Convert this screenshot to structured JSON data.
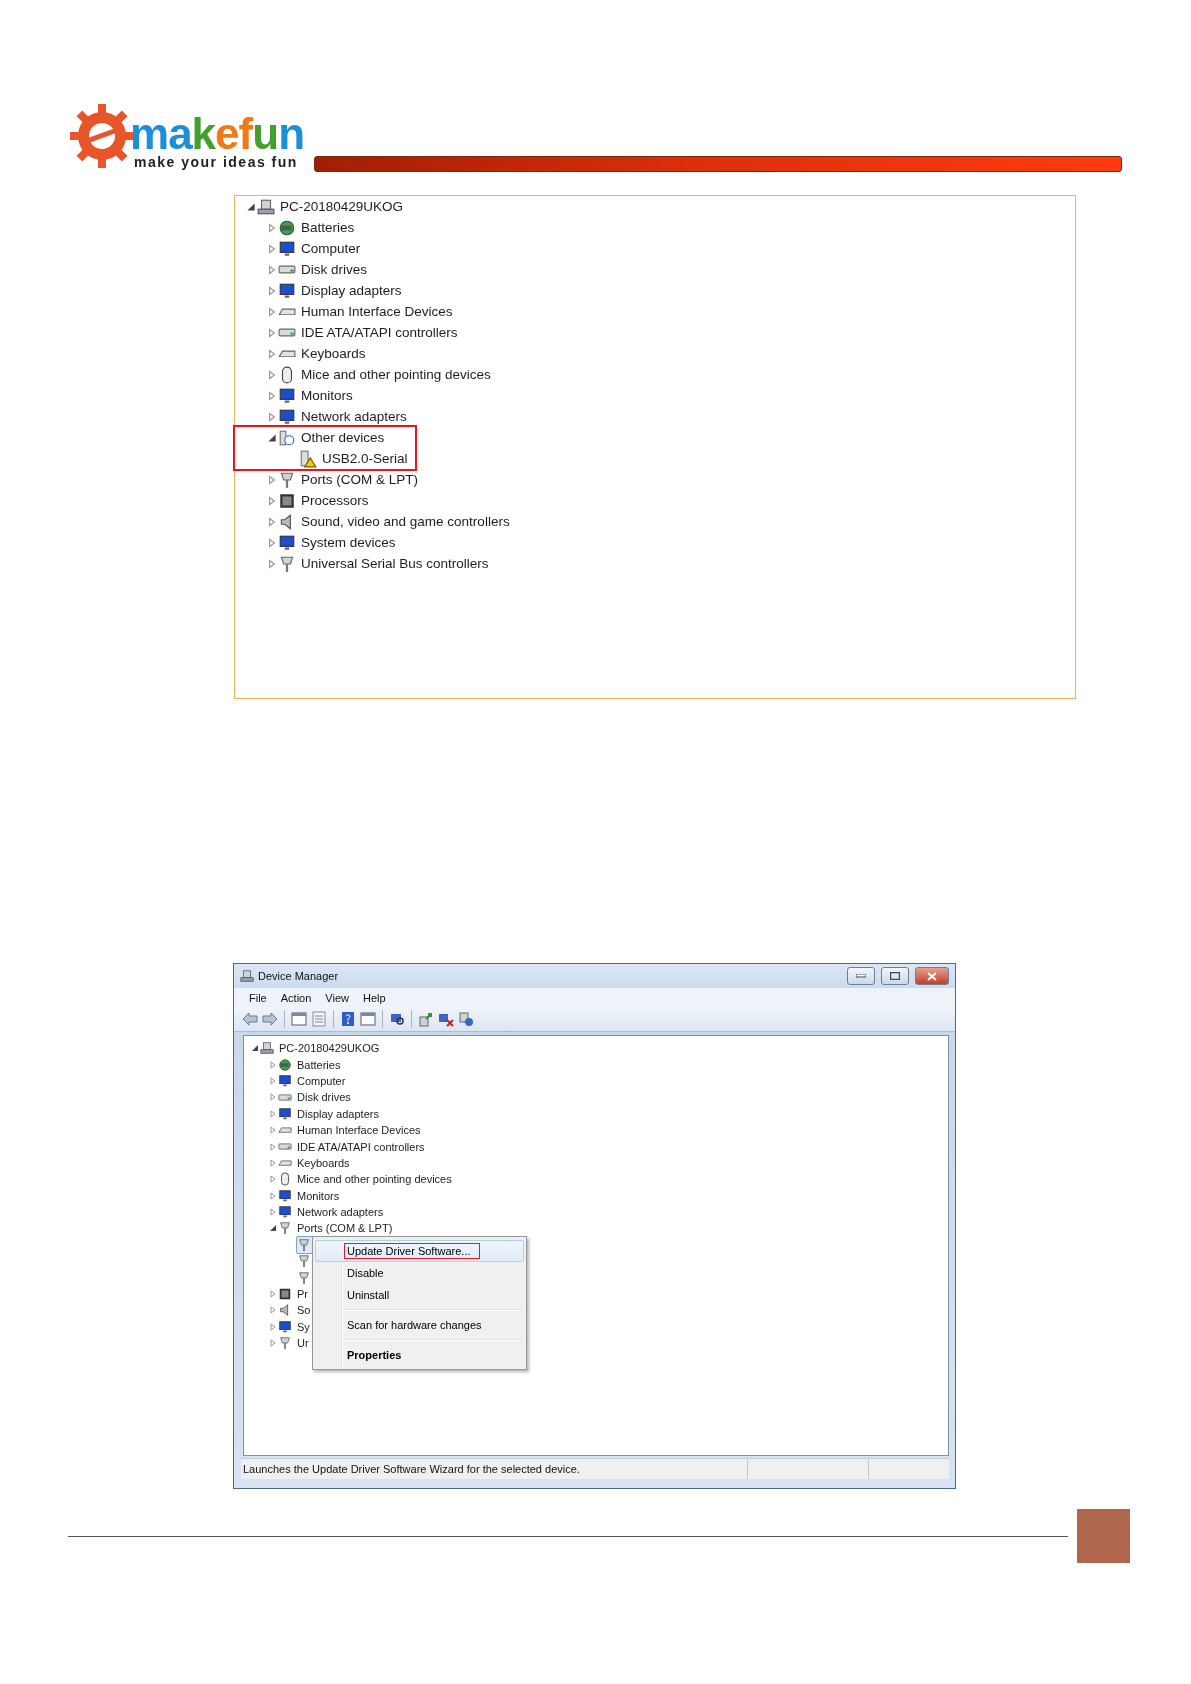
{
  "header": {
    "logo_text": "makefun",
    "tagline": "make your ideas fun"
  },
  "panel_tree": {
    "root": {
      "label": "PC-20180429UKOG",
      "kind": "computer-tower",
      "expanded": true,
      "children": [
        {
          "label": "Batteries",
          "kind": "battery",
          "expanded": false,
          "highlighted": false
        },
        {
          "label": "Computer",
          "kind": "monitor",
          "expanded": false,
          "highlighted": false
        },
        {
          "label": "Disk drives",
          "kind": "disk",
          "expanded": false,
          "highlighted": false
        },
        {
          "label": "Display adapters",
          "kind": "monitor",
          "expanded": false,
          "highlighted": false
        },
        {
          "label": "Human Interface Devices",
          "kind": "keyboard",
          "expanded": false,
          "highlighted": false
        },
        {
          "label": "IDE ATA/ATAPI controllers",
          "kind": "disk",
          "expanded": false,
          "highlighted": false
        },
        {
          "label": "Keyboards",
          "kind": "keyboard",
          "expanded": false,
          "highlighted": false
        },
        {
          "label": "Mice and other pointing devices",
          "kind": "mouse",
          "expanded": false,
          "highlighted": false
        },
        {
          "label": "Monitors",
          "kind": "monitor",
          "expanded": false,
          "highlighted": false
        },
        {
          "label": "Network adapters",
          "kind": "monitor",
          "expanded": false,
          "highlighted": false
        },
        {
          "label": "Other devices",
          "kind": "question",
          "expanded": true,
          "highlighted": true,
          "children": [
            {
              "label": "USB2.0-Serial",
              "kind": "warning"
            }
          ]
        },
        {
          "label": "Ports (COM & LPT)",
          "kind": "connector",
          "expanded": false,
          "highlighted": false
        },
        {
          "label": "Processors",
          "kind": "chip",
          "expanded": false,
          "highlighted": false
        },
        {
          "label": "Sound, video and game controllers",
          "kind": "speaker",
          "expanded": false,
          "highlighted": false
        },
        {
          "label": "System devices",
          "kind": "monitor",
          "expanded": false,
          "highlighted": false
        },
        {
          "label": "Universal Serial Bus controllers",
          "kind": "connector",
          "expanded": false,
          "highlighted": false
        }
      ]
    }
  },
  "window": {
    "title": "Device Manager",
    "menu": [
      "File",
      "Action",
      "View",
      "Help"
    ],
    "tree": {
      "root": {
        "label": "PC-20180429UKOG",
        "kind": "computer-tower",
        "expanded": true,
        "children": [
          {
            "label": "Batteries",
            "kind": "battery",
            "expanded": false
          },
          {
            "label": "Computer",
            "kind": "monitor",
            "expanded": false
          },
          {
            "label": "Disk drives",
            "kind": "disk",
            "expanded": false
          },
          {
            "label": "Display adapters",
            "kind": "monitor",
            "expanded": false
          },
          {
            "label": "Human Interface Devices",
            "kind": "keyboard",
            "expanded": false
          },
          {
            "label": "IDE ATA/ATAPI controllers",
            "kind": "disk",
            "expanded": false
          },
          {
            "label": "Keyboards",
            "kind": "keyboard",
            "expanded": false
          },
          {
            "label": "Mice and other pointing devices",
            "kind": "mouse",
            "expanded": false
          },
          {
            "label": "Monitors",
            "kind": "monitor",
            "expanded": false
          },
          {
            "label": "Network adapters",
            "kind": "monitor",
            "expanded": false
          },
          {
            "label": "Ports (COM & LPT)",
            "kind": "connector",
            "expanded": true,
            "children": [
              {
                "kind": "connector",
                "selected": true
              },
              {
                "kind": "connector",
                "selected": false
              },
              {
                "kind": "connector",
                "selected": false
              }
            ]
          },
          {
            "label": "Pr",
            "kind": "chip",
            "expanded": false
          },
          {
            "label": "So",
            "kind": "speaker",
            "expanded": false
          },
          {
            "label": "Sy",
            "kind": "monitor",
            "expanded": false
          },
          {
            "label": "Ur",
            "kind": "connector",
            "expanded": false
          }
        ]
      }
    },
    "context_menu": {
      "items": [
        {
          "kind": "item",
          "label": "Update Driver Software...",
          "selected": true,
          "annotated": true
        },
        {
          "kind": "item",
          "label": "Disable",
          "selected": false,
          "annotated": false
        },
        {
          "kind": "item",
          "label": "Uninstall",
          "selected": false,
          "annotated": false
        },
        {
          "kind": "separator"
        },
        {
          "kind": "item",
          "label": "Scan for hardware changes",
          "selected": false,
          "annotated": false
        },
        {
          "kind": "separator"
        },
        {
          "kind": "bold",
          "label": "Properties",
          "selected": false,
          "annotated": false
        }
      ]
    },
    "status_bar": "Launches the Update Driver Software Wizard for the selected device."
  }
}
